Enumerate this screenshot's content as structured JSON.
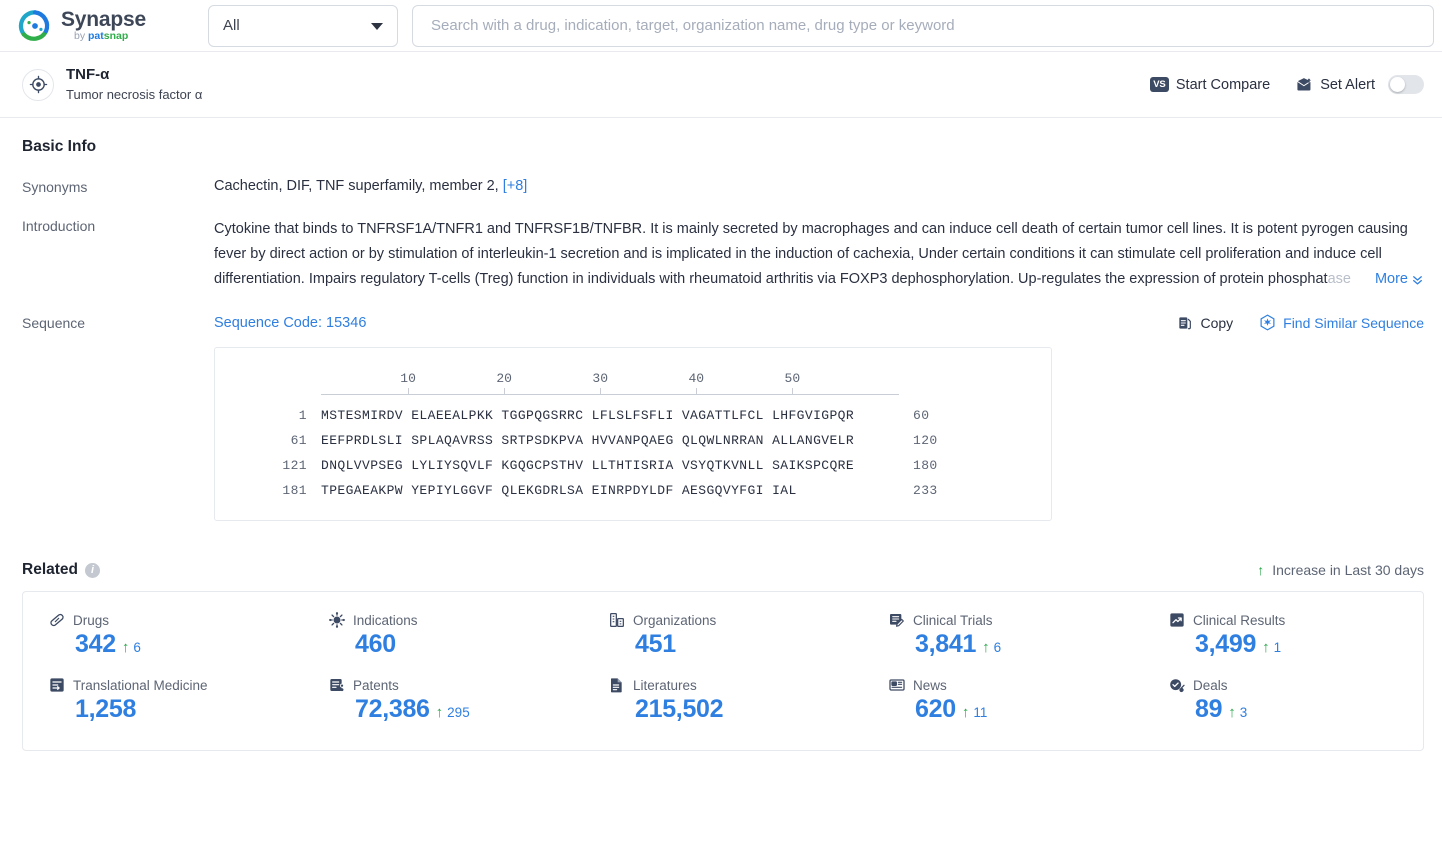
{
  "header": {
    "logo_name": "Synapse",
    "logo_by": "by",
    "logo_pat": "pat",
    "logo_snap": "snap",
    "scope_value": "All",
    "search_placeholder": "Search with a drug, indication, target, organization name, drug type or keyword"
  },
  "entity": {
    "title": "TNF-α",
    "subtitle": "Tumor necrosis factor α",
    "compare_label": "Start Compare",
    "compare_badge": "VS",
    "alert_label": "Set Alert",
    "alert_toggle_state": "off"
  },
  "basic_info": {
    "title": "Basic Info",
    "synonyms_label": "Synonyms",
    "synonyms_value": "Cachectin,  DIF,  TNF superfamily, member 2,",
    "synonyms_more": "[+8]",
    "introduction_label": "Introduction",
    "introduction_text": "Cytokine that binds to TNFRSF1A/TNFR1 and TNFRSF1B/TNFBR. It is mainly secreted by macrophages and can induce cell death of certain tumor cell lines. It is potent pyrogen causing fever by direct action or by stimulation of interleukin-1 secretion and is implicated in the induction of cachexia, Under certain conditions it can stimulate cell proliferation and induce cell differentiation. Impairs regulatory T-cells (Treg) function in individuals with rheumatoid arthritis via FOXP3 dephosphorylation. Up-regulates the expression of protein phosphat",
    "introduction_tail": "ase",
    "more_label": "More"
  },
  "sequence": {
    "label": "Sequence",
    "code_label": "Sequence Code: 15346",
    "copy_label": "Copy",
    "find_similar_label": "Find Similar Sequence",
    "ruler_ticks": [
      10,
      20,
      30,
      40,
      50
    ],
    "total_length": "233",
    "lines": [
      {
        "start": "1",
        "chunks": "MSTESMIRDV ELAEEALPKK TGGPQGSRRC LFLSLFSFLI VAGATTLFCL LHFGVIGPQR",
        "end": "60"
      },
      {
        "start": "61",
        "chunks": "EEFPRDLSLI SPLAQAVRSS SRTPSDKPVA HVVANPQAEG QLQWLNRRAN ALLANGVELR",
        "end": "120"
      },
      {
        "start": "121",
        "chunks": "DNQLVVPSEG LYLIYSQVLF KGQGCPSTHV LLTHTISRIA VSYQTKVNLL SAIKSPCQRE",
        "end": "180"
      },
      {
        "start": "181",
        "chunks": "TPEGAEAKPW YEPIYLGGVF QLEKGDRLSA EINRPDYLDF AESGQVYFGI IAL",
        "end": "233"
      }
    ]
  },
  "related": {
    "title": "Related",
    "info_glyph": "i",
    "legend_label": "Increase in Last 30 days",
    "legend_arrow": "↑",
    "stats": [
      {
        "label": "Drugs",
        "icon": "pill-icon",
        "value": "342",
        "delta": "6"
      },
      {
        "label": "Indications",
        "icon": "virus-icon",
        "value": "460",
        "delta": ""
      },
      {
        "label": "Organizations",
        "icon": "building-icon",
        "value": "451",
        "delta": ""
      },
      {
        "label": "Clinical Trials",
        "icon": "clipboard-edit-icon",
        "value": "3,841",
        "delta": "6"
      },
      {
        "label": "Clinical Results",
        "icon": "chart-arrow-icon",
        "value": "3,499",
        "delta": "1"
      },
      {
        "label": "Translational Medicine",
        "icon": "transfer-doc-icon",
        "value": "1,258",
        "delta": ""
      },
      {
        "label": "Patents",
        "icon": "patent-icon",
        "value": "72,386",
        "delta": "295"
      },
      {
        "label": "Literatures",
        "icon": "document-icon",
        "value": "215,502",
        "delta": ""
      },
      {
        "label": "News",
        "icon": "news-icon",
        "value": "620",
        "delta": "11"
      },
      {
        "label": "Deals",
        "icon": "handshake-icon",
        "value": "89",
        "delta": "3"
      }
    ]
  },
  "colors": {
    "accent_blue": "#2f7fe0",
    "increase_green": "#2aa84a",
    "text_dark": "#1e2430",
    "text_muted": "#5d6574"
  }
}
